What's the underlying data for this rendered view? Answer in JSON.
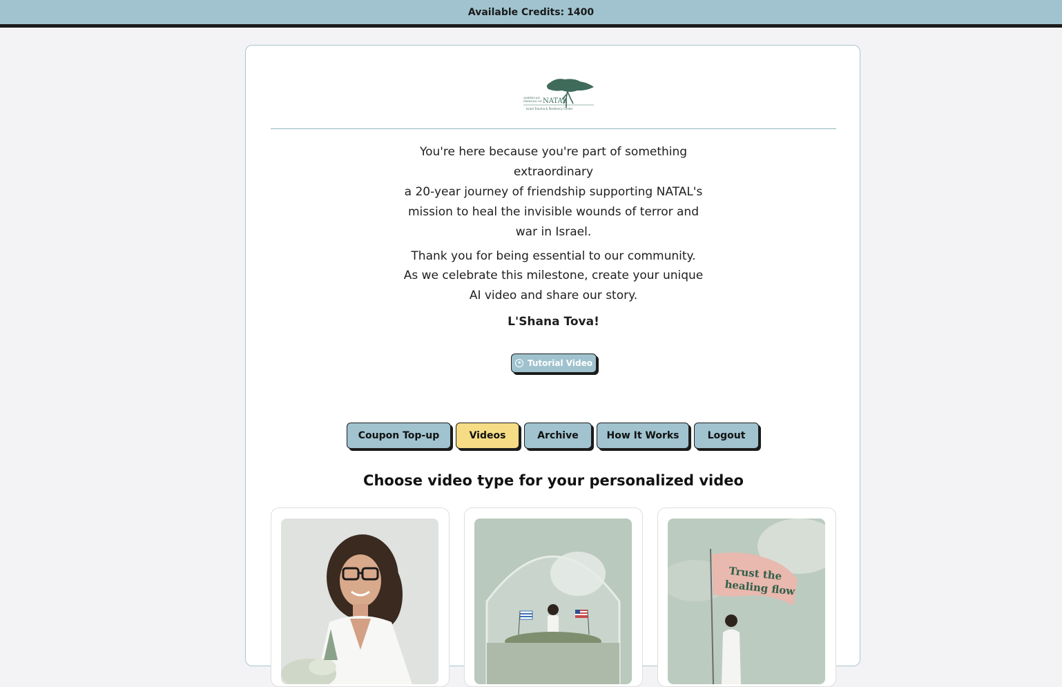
{
  "topbar": {
    "credits_label": "Available Credits:",
    "credits_value": "1400"
  },
  "intro": {
    "line1": "You're here because you're part of something extraordinary",
    "line2": "a 20-year journey of friendship supporting NATAL's mission to heal the invisible wounds of terror and war in Israel.",
    "line3": "Thank you for being essential to our community.",
    "line4": "As we celebrate this milestone, create your unique AI video and share our story.",
    "greeting": "L'Shana Tova!"
  },
  "tutorial_button": {
    "label": "Tutorial Video",
    "icon": "play-circle-icon"
  },
  "nav": {
    "items": [
      {
        "label": "Coupon Top-up",
        "active": false
      },
      {
        "label": "Videos",
        "active": true
      },
      {
        "label": "Archive",
        "active": false
      },
      {
        "label": "How It Works",
        "active": false
      },
      {
        "label": "Logout",
        "active": false
      }
    ]
  },
  "section_title": "Choose video type for your personalized video",
  "tiles": [
    {
      "description": "woman-with-glasses-portrait"
    },
    {
      "description": "woman-in-glass-dome-with-flags"
    },
    {
      "description": "woman-under-flag",
      "flag_text": "Trust the healing flow"
    }
  ],
  "colors": {
    "topbar": "#a0c3cf",
    "button": "#a0c3cf",
    "active_button": "#f5dc85",
    "accent_border": "#1b1b1b"
  }
}
